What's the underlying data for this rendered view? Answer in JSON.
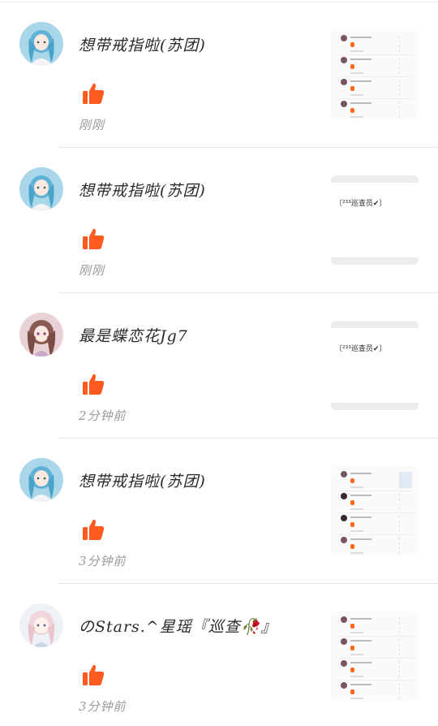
{
  "notifications": [
    {
      "username": "想带戒指啦(苏团)",
      "timestamp": "刚刚",
      "avatar": "avatar-blue-hair-girl",
      "thumbnail": {
        "kind": "screenshot"
      }
    },
    {
      "username": "想带戒指啦(苏团)",
      "timestamp": "刚刚",
      "avatar": "avatar-blue-hair-girl",
      "thumbnail": {
        "kind": "text",
        "text": "〔²³³巡查员✔〕"
      }
    },
    {
      "username": "最是蝶恋花Jg7",
      "timestamp": "2分钟前",
      "avatar": "avatar-pink-hair-girl",
      "thumbnail": {
        "kind": "text",
        "text": "〔²³³巡查员✔〕"
      }
    },
    {
      "username": "想带戒指啦(苏团)",
      "timestamp": "3分钟前",
      "avatar": "avatar-blue-hair-girl",
      "thumbnail": {
        "kind": "screenshot"
      }
    },
    {
      "username": "のStars.^星瑶『巡查🥀』",
      "timestamp": "3分钟前",
      "avatar": "avatar-white-hair-girl",
      "thumbnail": {
        "kind": "screenshot"
      }
    }
  ],
  "colors": {
    "like": "#ff5a1f",
    "timestamp": "#9a9a9a",
    "divider": "#e8e8e8"
  }
}
